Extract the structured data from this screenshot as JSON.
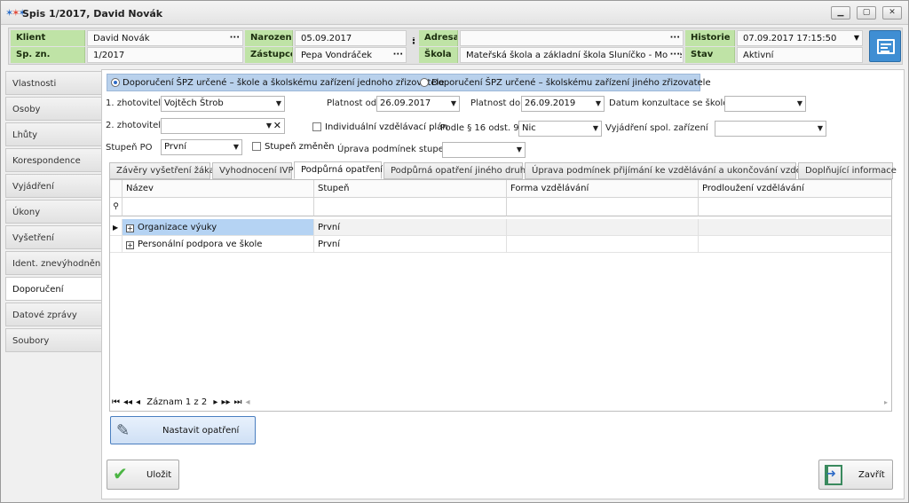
{
  "window": {
    "title": "Spis 1/2017, David Novák",
    "icon": "app-logo-icon"
  },
  "header": {
    "klient_label": "Klient",
    "klient_value": "David Novák",
    "spzn_label": "Sp. zn.",
    "spzn_value": "1/2017",
    "narozeni_label": "Narození",
    "narozeni_value": "05.09.2017",
    "zastupce_label": "Zástupce",
    "zastupce_value": "Pepa Vondráček",
    "adresa_label": "Adresa",
    "adresa_value": "",
    "skola_label": "Škola",
    "skola_value": "Mateřská škola a základní škola Sluníčko - Montessor",
    "historie_label": "Historie",
    "historie_value": "07.09.2017 17:15:50",
    "stav_label": "Stav",
    "stav_value": "Aktivní",
    "ellipsis": "···"
  },
  "sidebar": {
    "items": [
      {
        "label": "Vlastnosti"
      },
      {
        "label": "Osoby"
      },
      {
        "label": "Lhůty"
      },
      {
        "label": "Korespondence"
      },
      {
        "label": "Vyjádření"
      },
      {
        "label": "Úkony"
      },
      {
        "label": "Vyšetření"
      },
      {
        "label": "Ident. znevýhodnění"
      },
      {
        "label": "Doporučení",
        "active": true
      },
      {
        "label": "Datové zprávy"
      },
      {
        "label": "Soubory"
      }
    ]
  },
  "form": {
    "radio1": "Doporučení ŠPZ určené – škole a školskému zařízení jednoho zřizovatele",
    "radio2": "Doporučení ŠPZ určené – školskému zařízení jiného zřizovatele",
    "zhotovitel1_label": "1. zhotovitel",
    "zhotovitel1_value": "Vojtěch Štrob",
    "zhotovitel2_label": "2. zhotovitel",
    "zhotovitel2_value": "",
    "platnost_od_label": "Platnost od",
    "platnost_od_value": "26.09.2017",
    "platnost_do_label": "Platnost do",
    "platnost_do_value": "26.09.2019",
    "datum_konzultace_label": "Datum konzultace se školou",
    "datum_konzultace_value": "",
    "ivp_label": "Individuální vzdělávací plán",
    "podle_label": "Podle § 16 odst. 9",
    "podle_value": "Nic",
    "vyjadreni_label": "Vyjádření spol. zařízení",
    "vyjadreni_value": "",
    "stupen_po_label": "Stupeň PO",
    "stupen_po_value": "První",
    "stupen_zmenen_label": "Stupeň změněn",
    "uprava_label": "Úprava podmínek stupeň",
    "uprava_value": ""
  },
  "tabs": [
    {
      "label": "Závěry vyšetření žáka"
    },
    {
      "label": "Vyhodnocení IVP"
    },
    {
      "label": "Podpůrná opatření",
      "active": true
    },
    {
      "label": "Podpůrná opatření jiného druhu"
    },
    {
      "label": "Úprava podmínek přijímání ke vzdělávání a ukončování vzdělávání"
    },
    {
      "label": "Doplňující informace"
    }
  ],
  "grid": {
    "columns": [
      "Název",
      "Stupeň",
      "Forma vzdělávání",
      "Prodloužení vzdělávání"
    ],
    "filter_icon": "filter-icon",
    "rows": [
      {
        "nazev": "Organizace výuky",
        "stupen": "První",
        "forma": "",
        "prodlouzeni": "",
        "selected": true
      },
      {
        "nazev": "Personální podpora ve škole",
        "stupen": "První",
        "forma": "",
        "prodlouzeni": ""
      }
    ],
    "pager": "Záznam 1 z 2"
  },
  "buttons": {
    "nastavit": "Nastavit opatření",
    "ulozit": "Uložit",
    "zavrit": "Zavřít"
  },
  "colors": {
    "header_label_bg": "#bfe3a6",
    "radio_bar_bg": "#b9d1ec",
    "accent": "#3f8ed3",
    "selected_row": "#b5d3f3"
  }
}
